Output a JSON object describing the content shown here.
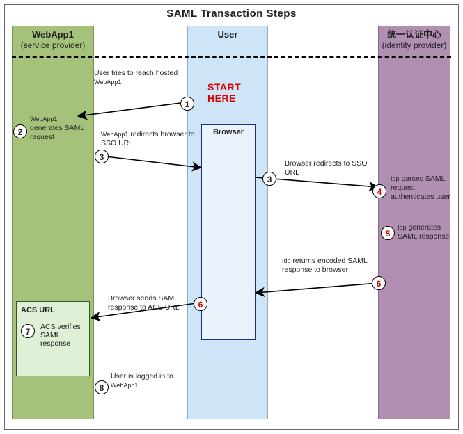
{
  "title": "SAML Transaction Steps",
  "columns": {
    "sp": {
      "name": "WebApp1",
      "role": "(service provider)"
    },
    "user": {
      "name": "User"
    },
    "idp": {
      "name": "统一认证中心",
      "role": "(identity provider)"
    }
  },
  "browser_label": "Browser",
  "acs_box": {
    "title": "ACS URL"
  },
  "start_here": "START\nHERE",
  "steps": {
    "s1": {
      "num": "1",
      "text": "User tries to reach hosted ",
      "obj": "WebApp1"
    },
    "s2": {
      "num": "2",
      "subj": "WebApp1",
      "text": " generates SAML request"
    },
    "s3a": {
      "num": "3",
      "subj": "WebApp1",
      "text": " redirects browser to SSO URL"
    },
    "s3b": {
      "num": "3",
      "text": "Browser redirects to SSO URL"
    },
    "s4": {
      "num": "4",
      "subj": "Idp",
      "text": " parses SAML request, authenticates user"
    },
    "s5": {
      "num": "5",
      "subj": "Idp",
      "text": " generates SAML response"
    },
    "s6a": {
      "num": "6",
      "subj": "Idp",
      "text": " returns encoded SAML response to browser"
    },
    "s6b": {
      "num": "6",
      "text": "Browser sends SAML response to ACS URL"
    },
    "s7": {
      "num": "7",
      "text": "ACS verifies SAML response"
    },
    "s8": {
      "num": "8",
      "text": "User is logged in to ",
      "obj": "WebApp1"
    }
  }
}
